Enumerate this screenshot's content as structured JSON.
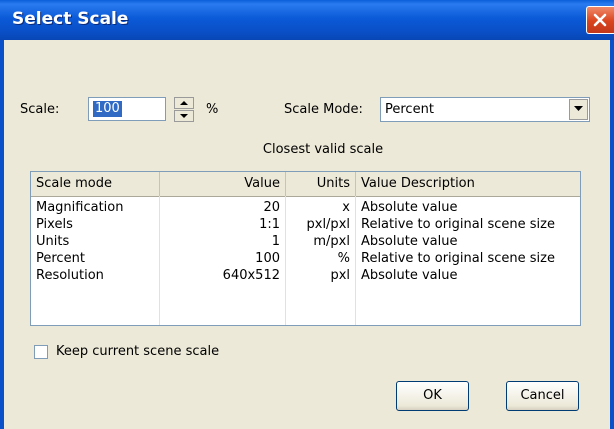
{
  "window": {
    "title": "Select Scale"
  },
  "scale": {
    "label": "Scale:",
    "value": "100",
    "unit_label": "%"
  },
  "scale_mode": {
    "label": "Scale Mode:",
    "selected": "Percent"
  },
  "closest_label": "Closest valid scale",
  "table": {
    "columns": [
      "Scale mode",
      "Value",
      "Units",
      "Value Description"
    ],
    "rows": [
      [
        "Magnification",
        "20",
        "x",
        "Absolute value"
      ],
      [
        "Pixels",
        "1:1",
        "pxl/pxl",
        "Relative to original scene size"
      ],
      [
        "Units",
        "1",
        "m/pxl",
        "Absolute value"
      ],
      [
        "Percent",
        "100",
        "%",
        "Relative to original scene size"
      ],
      [
        "Resolution",
        "640x512",
        "pxl",
        "Absolute value"
      ]
    ]
  },
  "keep_scale": {
    "label": "Keep current scene scale",
    "checked": false
  },
  "buttons": {
    "ok": "OK",
    "cancel": "Cancel"
  },
  "icons": {
    "close": "close-icon",
    "spin_up": "spin-up-icon",
    "spin_down": "spin-down-icon",
    "dropdown": "chevron-down-icon"
  },
  "colors": {
    "title_bar": "#0a5fd8",
    "close_button": "#d9441e",
    "selection": "#316ac5",
    "dialog_bg": "#ece9d8"
  }
}
